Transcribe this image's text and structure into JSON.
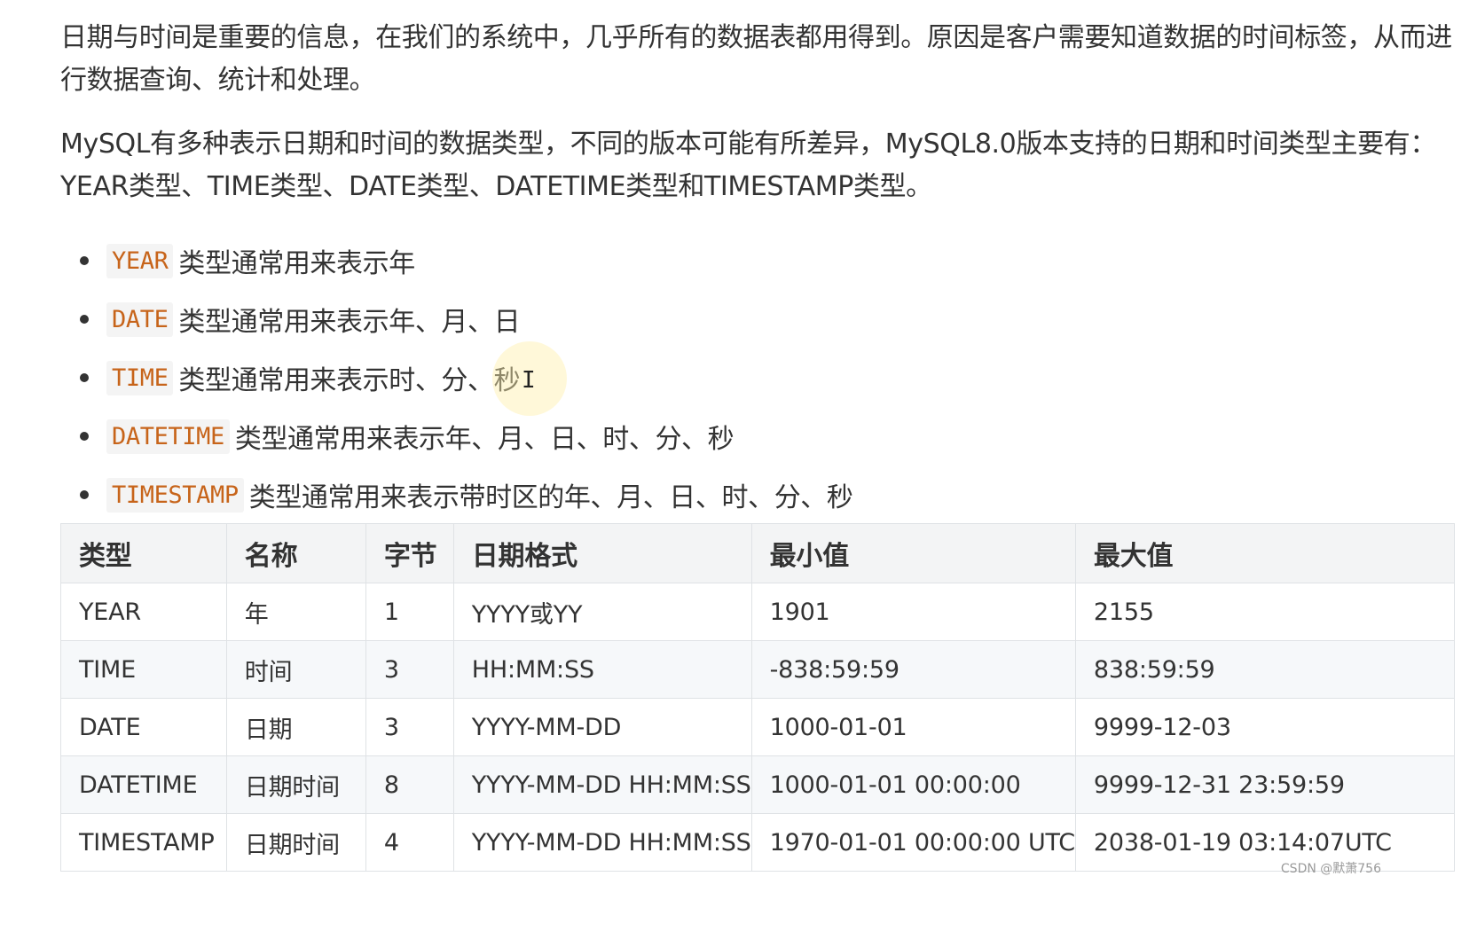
{
  "paragraphs": [
    "日期与时间是重要的信息，在我们的系统中，几乎所有的数据表都用得到。原因是客户需要知道数据的时间标签，从而进行数据查询、统计和处理。",
    "MySQL有多种表示日期和时间的数据类型，不同的版本可能有所差异，MySQL8.0版本支持的日期和时间类型主要有：YEAR类型、TIME类型、DATE类型、DATETIME类型和TIMESTAMP类型。"
  ],
  "bullets": [
    {
      "code": "YEAR",
      "text": "类型通常用来表示年"
    },
    {
      "code": "DATE",
      "text": "类型通常用来表示年、月、日"
    },
    {
      "code": "TIME",
      "text": "类型通常用来表示时、分、秒"
    },
    {
      "code": "DATETIME",
      "text": "类型通常用来表示年、月、日、时、分、秒"
    },
    {
      "code": "TIMESTAMP",
      "text": "类型通常用来表示带时区的年、月、日、时、分、秒"
    }
  ],
  "table": {
    "headers": [
      "类型",
      "名称",
      "字节",
      "日期格式",
      "最小值",
      "最大值"
    ],
    "rows": [
      [
        "YEAR",
        "年",
        "1",
        "YYYY或YY",
        "1901",
        "2155"
      ],
      [
        "TIME",
        "时间",
        "3",
        "HH:MM:SS",
        "-838:59:59",
        "838:59:59"
      ],
      [
        "DATE",
        "日期",
        "3",
        "YYYY-MM-DD",
        "1000-01-01",
        "9999-12-03"
      ],
      [
        "DATETIME",
        "日期时间",
        "8",
        "YYYY-MM-DD HH:MM:SS",
        "1000-01-01 00:00:00",
        "9999-12-31 23:59:59"
      ],
      [
        "TIMESTAMP",
        "日期时间",
        "4",
        "YYYY-MM-DD HH:MM:SS",
        "1970-01-01 00:00:00 UTC",
        "2038-01-19 03:14:07UTC"
      ]
    ]
  },
  "cursor_glyph": "I",
  "watermark": "CSDN @默萧756"
}
